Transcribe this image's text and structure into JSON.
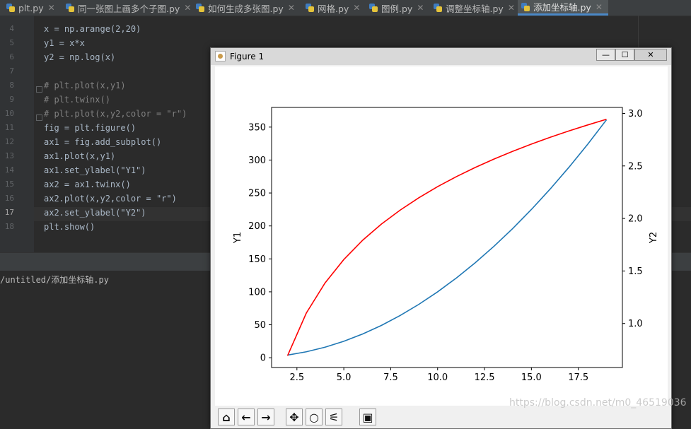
{
  "tabs": [
    {
      "label": "plt.py"
    },
    {
      "label": "同一张图上画多个子图.py"
    },
    {
      "label": "如何生成多张图.py"
    },
    {
      "label": "网格.py"
    },
    {
      "label": "图例.py"
    },
    {
      "label": "调整坐标轴.py"
    },
    {
      "label": "添加坐标轴.py"
    }
  ],
  "editor": {
    "line_numbers": [
      "4",
      "5",
      "6",
      "7",
      "8",
      "9",
      "10",
      "11",
      "12",
      "13",
      "14",
      "15",
      "16",
      "17",
      "18"
    ],
    "lines": [
      "x = np.arange(2,20)",
      "y1 = x*x",
      "y2 = np.log(x)",
      "",
      "# plt.plot(x,y1)",
      "# plt.twinx()",
      "# plt.plot(x,y2,color = \"r\")",
      "fig = plt.figure()",
      "ax1 = fig.add_subplot()",
      "ax1.plot(x,y1)",
      "ax1.set_ylabel(\"Y1\")",
      "ax2 = ax1.twinx()",
      "ax2.plot(x,y2,color = \"r\")",
      "ax2.set_ylabel(\"Y2\")",
      "plt.show()"
    ]
  },
  "run_panel": {
    "path": "/untitled/添加坐标轴.py"
  },
  "figure_window": {
    "title": "Figure 1",
    "minimize": "—",
    "maximize": "☐",
    "close": "✕"
  },
  "toolbar": {
    "icons": [
      "home-icon",
      "back-arrow-icon",
      "forward-arrow-icon",
      "pan-icon",
      "zoom-icon",
      "configure-subplots-icon",
      "save-icon"
    ]
  },
  "chart_data": {
    "type": "line",
    "x": [
      2,
      3,
      4,
      5,
      6,
      7,
      8,
      9,
      10,
      11,
      12,
      13,
      14,
      15,
      16,
      17,
      18,
      19
    ],
    "series": [
      {
        "axis": "left",
        "color": "#1f77b4",
        "values": [
          4,
          9,
          16,
          25,
          36,
          49,
          64,
          81,
          100,
          121,
          144,
          169,
          196,
          225,
          256,
          289,
          324,
          361
        ]
      },
      {
        "axis": "right",
        "color": "#ff0000",
        "values": [
          0.693,
          1.099,
          1.386,
          1.609,
          1.792,
          1.946,
          2.079,
          2.197,
          2.303,
          2.398,
          2.485,
          2.565,
          2.639,
          2.708,
          2.773,
          2.833,
          2.89,
          2.944
        ]
      }
    ],
    "ylabel": "Y1",
    "y2label": "Y2",
    "xlim": [
      1.15,
      19.85
    ],
    "ylim": [
      -14.85,
      379.85
    ],
    "y2lim": [
      0.581,
      3.057
    ],
    "xticks": [
      "2.5",
      "5.0",
      "7.5",
      "10.0",
      "12.5",
      "15.0",
      "17.5"
    ],
    "yticks": [
      "0",
      "50",
      "100",
      "150",
      "200",
      "250",
      "300",
      "350"
    ],
    "y2ticks": [
      "1.0",
      "1.5",
      "2.0",
      "2.5",
      "3.0"
    ]
  },
  "watermark": "https://blog.csdn.net/m0_46519036"
}
